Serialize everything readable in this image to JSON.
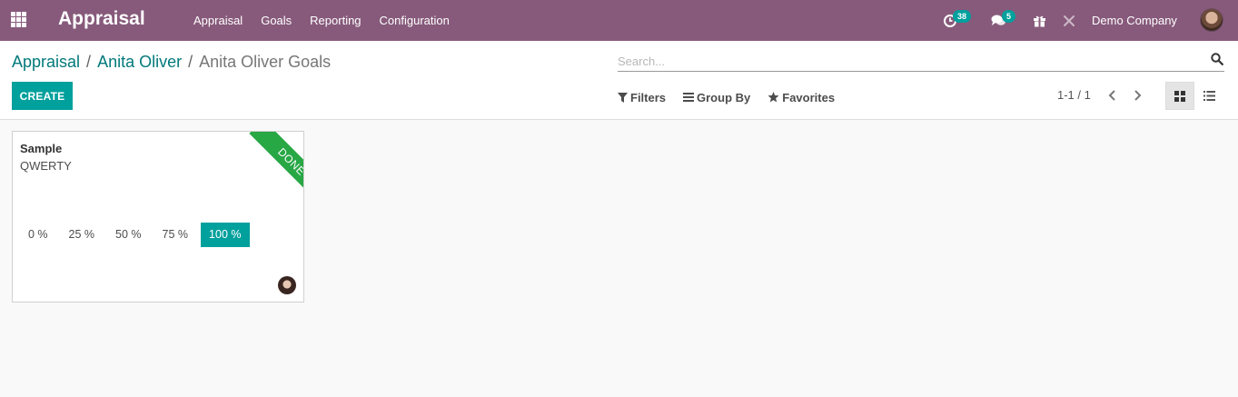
{
  "navbar": {
    "app_title": "Appraisal",
    "menu": [
      "Appraisal",
      "Goals",
      "Reporting",
      "Configuration"
    ],
    "activity_count": "38",
    "messages_count": "5",
    "company": "Demo Company"
  },
  "breadcrumb": {
    "items": [
      "Appraisal",
      "Anita Oliver"
    ],
    "current": "Anita Oliver Goals"
  },
  "search": {
    "placeholder": "Search..."
  },
  "toolbar": {
    "create_label": "CREATE",
    "filters_label": "Filters",
    "group_by_label": "Group By",
    "favorites_label": "Favorites",
    "pager": "1-1 / 1"
  },
  "card": {
    "title": "Sample",
    "subtitle": "QWERTY",
    "ribbon": "DONE",
    "progress_options": [
      "0 %",
      "25 %",
      "50 %",
      "75 %",
      "100 %"
    ],
    "progress_selected": "100 %"
  },
  "colors": {
    "navbar": "#875a7b",
    "accent": "#00a09d",
    "ribbon": "#28a745",
    "link": "#01797a"
  }
}
